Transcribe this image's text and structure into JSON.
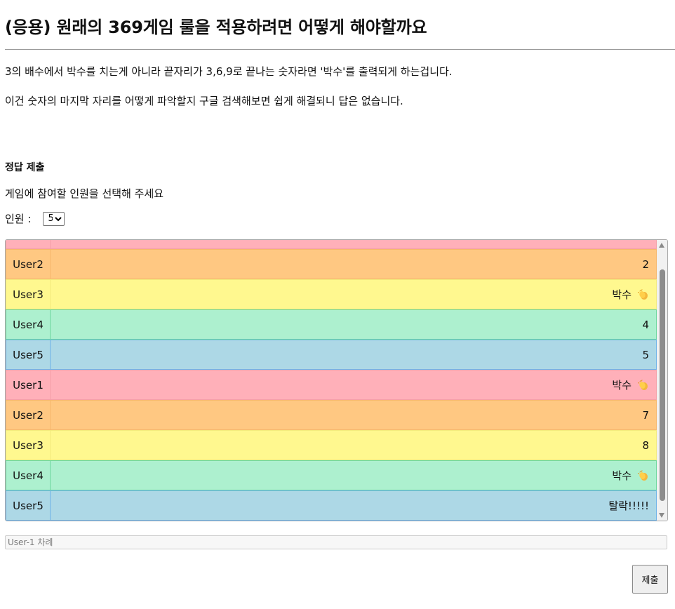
{
  "page": {
    "title": "(응용) 원래의 369게임 룰을 적용하려면 어떻게 해야할까요",
    "description": [
      "3의 배수에서 박수를 치는게 아니라 끝자리가 3,6,9로 끝나는 숫자라면 '박수'를 출력되게 하는겁니다.",
      "이건 숫자의 마지막 자리를 어떻게 파악할지 구글 검색해보면 쉽게 해결되니 답은 없습니다."
    ]
  },
  "form": {
    "section_title": "정답 제출",
    "instruction": "게임에 참여할 인원을 선택해 주세요",
    "count_label": "인원 :",
    "count_value": "5",
    "turn_placeholder": "User-1 차례",
    "submit_label": "제출"
  },
  "board": {
    "rows": [
      {
        "user": "",
        "value": "",
        "clap": false,
        "color": "#ffb0b9"
      },
      {
        "user": "User2",
        "value": "2",
        "clap": false,
        "color": "#ffc882"
      },
      {
        "user": "User3",
        "value": "박수",
        "clap": true,
        "color": "#fff88f"
      },
      {
        "user": "User4",
        "value": "4",
        "clap": false,
        "color": "#adf0cf"
      },
      {
        "user": "User5",
        "value": "5",
        "clap": false,
        "color": "#add8e6"
      },
      {
        "user": "User1",
        "value": "박수",
        "clap": true,
        "color": "#ffb0b9"
      },
      {
        "user": "User2",
        "value": "7",
        "clap": false,
        "color": "#ffc882"
      },
      {
        "user": "User3",
        "value": "8",
        "clap": false,
        "color": "#fff88f"
      },
      {
        "user": "User4",
        "value": "박수",
        "clap": true,
        "color": "#adf0cf"
      },
      {
        "user": "User5",
        "value": "탈락!!!!!",
        "clap": false,
        "color": "#add8e6"
      }
    ],
    "clap_icon": "clapping-hands-icon"
  }
}
